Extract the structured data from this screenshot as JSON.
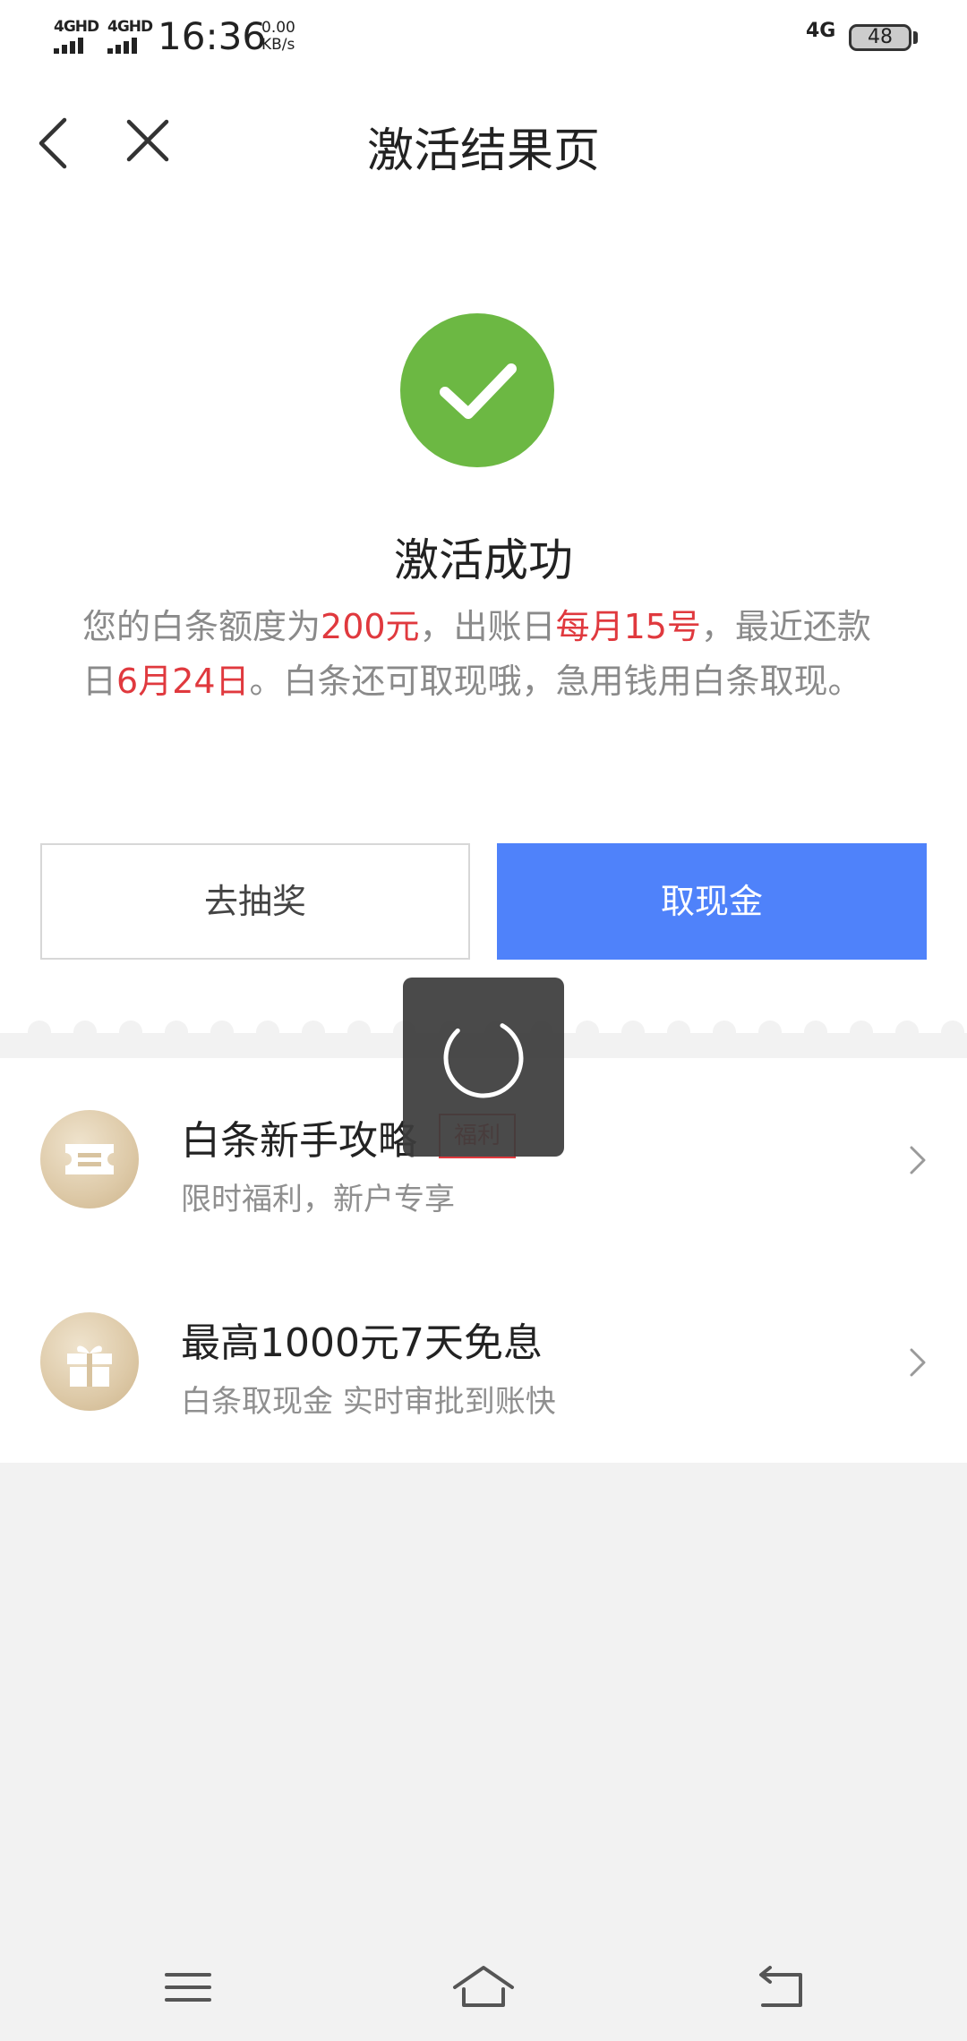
{
  "status_bar": {
    "signal1_label": "4GHD",
    "signal2_label": "4GHD",
    "time": "16:36",
    "speed_value": "0.00",
    "speed_unit": "KB/s",
    "network": "4G",
    "battery": "48"
  },
  "header": {
    "title": "激活结果页",
    "back_icon": "chevron-left-icon",
    "close_icon": "close-icon"
  },
  "result": {
    "icon": "check-circle-icon",
    "title": "激活成功",
    "desc_parts": [
      "您的白条额度为",
      "200元",
      "，出账日",
      "每月15号",
      "，最近还款日",
      "6月24日",
      "。白条还可取现哦，急用钱用白条取现。"
    ]
  },
  "buttons": {
    "lottery": "去抽奖",
    "cash": "取现金"
  },
  "list": [
    {
      "title": "白条新手攻略",
      "badge": "福利",
      "subtitle": "限时福利，新户专享",
      "icon": "ticket-icon"
    },
    {
      "title": "最高1000元7天免息",
      "subtitle": "白条取现金 实时审批到账快",
      "icon": "gift-icon"
    }
  ],
  "colors": {
    "accent": "#4f82fa",
    "success": "#6cb843",
    "highlight": "#e0393e"
  }
}
